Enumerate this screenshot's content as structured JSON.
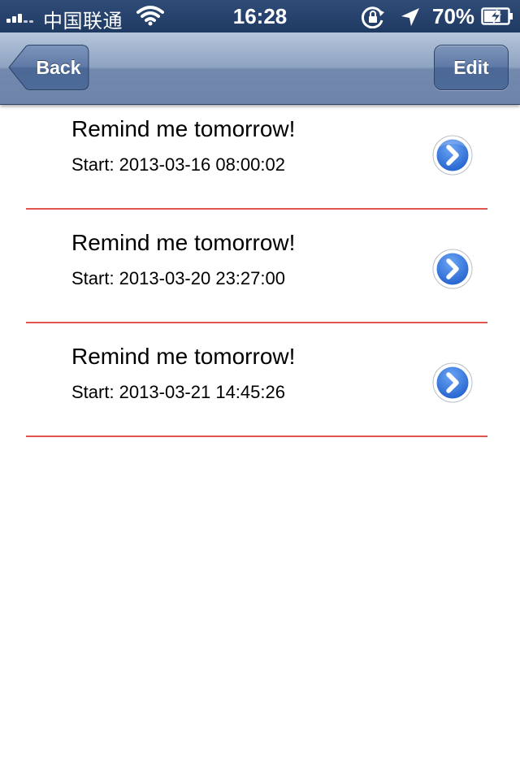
{
  "status_bar": {
    "carrier": "中国联通",
    "time": "16:28",
    "battery": "70%",
    "battery_level": 0.7,
    "icons": [
      "signal-icon",
      "wifi-icon",
      "rotation-lock-icon",
      "location-arrow-icon",
      "battery-charging-icon"
    ]
  },
  "nav": {
    "back_label": "Back",
    "edit_label": "Edit"
  },
  "reminders": [
    {
      "title": "Remind me tomorrow!",
      "start": "Start: 2013-03-16 08:00:02"
    },
    {
      "title": "Remind me tomorrow!",
      "start": "Start: 2013-03-20 23:27:00"
    },
    {
      "title": "Remind me tomorrow!",
      "start": "Start: 2013-03-21 14:45:26"
    }
  ],
  "colors": {
    "divider": "#e4554f",
    "nav_bar": "#8ea3c1",
    "disclosure": "#2e6bd6"
  }
}
